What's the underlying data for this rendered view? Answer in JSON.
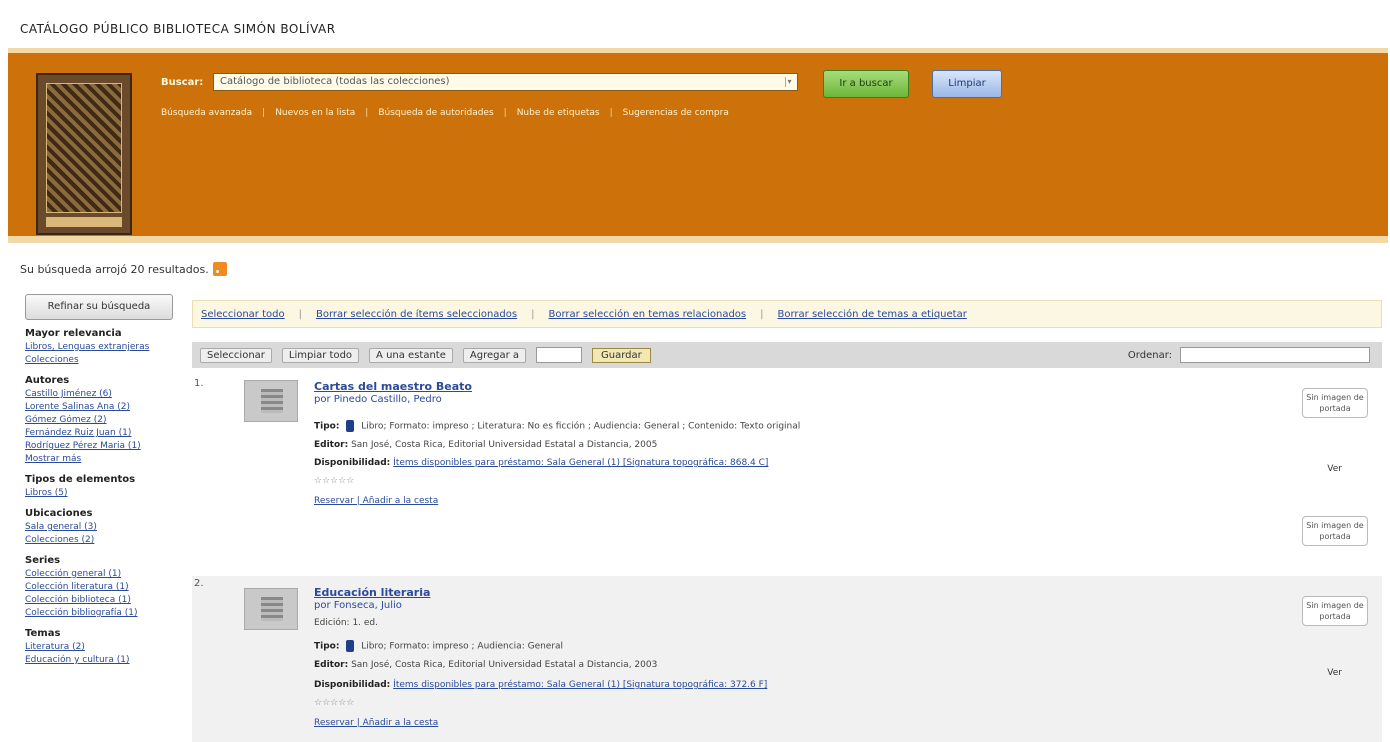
{
  "page_title": "CATÁLOGO PÚBLICO BIBLIOTECA SIMÓN BOLÍVAR",
  "header": {
    "search_label": "Buscar:",
    "search_value": "Catálogo de biblioteca (todas las colecciones)",
    "search_button": "Ir a buscar",
    "clear_button": "Limpiar",
    "links": [
      "Búsqueda avanzada",
      "Nuevos en la lista",
      "Búsqueda de autoridades",
      "Nube de etiquetas",
      "Sugerencias de compra"
    ]
  },
  "results": {
    "count_text": "Su búsqueda arrojó 20 resultados."
  },
  "sidebar": {
    "refine_button": "Refinar su búsqueda",
    "facets": [
      {
        "title": "Mayor relevancia",
        "items": [
          "Libros, Lenguas extranjeras",
          "Colecciones"
        ]
      },
      {
        "title": "Autores",
        "items": [
          "Castillo Jiménez (6)",
          "Lorente Salinas Ana (2)",
          "Gómez Gómez (2)",
          "Fernández Ruiz Juan (1)",
          "Rodríguez Pérez Maria (1)",
          "Mostrar más"
        ]
      },
      {
        "title": "Tipos de elementos",
        "items": [
          "Libros (5)"
        ]
      },
      {
        "title": "Ubicaciones",
        "items": [
          "Sala general (3)",
          "Colecciones (2)"
        ]
      },
      {
        "title": "Series",
        "items": [
          "Colección general (1)",
          "Colección literatura (1)",
          "Colección biblioteca (1)",
          "Colección bibliografía (1)"
        ]
      },
      {
        "title": "Temas",
        "items": [
          "Literatura (2)",
          "Educación y cultura (1)"
        ]
      }
    ]
  },
  "toolbar": {
    "select_all": "Seleccionar todo",
    "links": [
      "Borrar selección de ítems seleccionados",
      "Borrar selección en temas relacionados",
      "Borrar selección de temas a etiquetar"
    ],
    "page_controls": [
      "Seleccionar",
      "Limpiar todo",
      "A una estante",
      "Agregar a"
    ],
    "go_button": "Guardar",
    "sort_label": "Ordenar:"
  },
  "items": [
    {
      "num": "1.",
      "title": "Cartas del maestro Beato",
      "author": "por Pinedo Castillo, Pedro",
      "type_prefix": "Tipo:",
      "type_text": "Libro; Formato: impreso ; Literatura: No es ficción ; Audiencia: General ; Contenido: Texto original",
      "detail_label": "Editor:",
      "detail_text": "San José, Costa Rica, Editorial Universidad Estatal a Distancia, 2005",
      "availability_label": "Disponibilidad:",
      "availability_text": "Ítems disponibles para préstamo: Sala General (1) [Signatura topográfica: 868.4 C]",
      "actions": "Reservar | Añadir a la cesta",
      "side_top": "Sin imagen de portada",
      "side_label": "Ver",
      "side_bottom": "Sin imagen de portada"
    },
    {
      "num": "2.",
      "title": "Educación literaria",
      "author": "por Fonseca, Julio",
      "edition": "Edición: 1. ed.",
      "type_prefix": "Tipo:",
      "type_text": "Libro; Formato: impreso ; Audiencia: General",
      "detail_label": "Editor:",
      "detail_text": "San José, Costa Rica, Editorial Universidad Estatal a Distancia, 2003",
      "availability_label": "Disponibilidad:",
      "availability_text": "Ítems disponibles para préstamo: Sala General (1) [Signatura topográfica: 372.6 F]",
      "actions": "Reservar | Añadir a la cesta",
      "side_top": "Sin imagen de portada",
      "side_label": "Ver"
    }
  ]
}
